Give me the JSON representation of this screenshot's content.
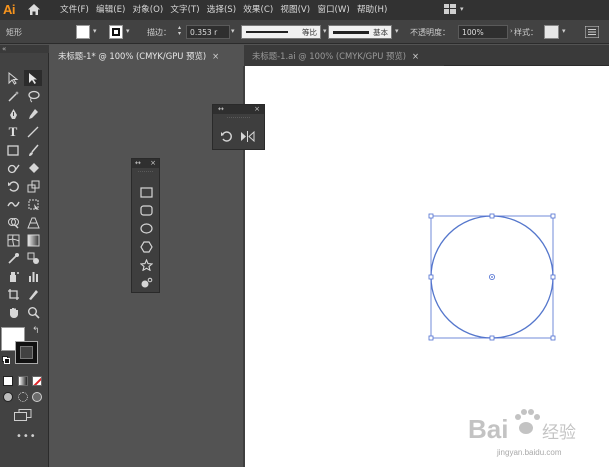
{
  "app": {
    "logo": "Ai"
  },
  "menu": [
    "文件(F)",
    "编辑(E)",
    "对象(O)",
    "文字(T)",
    "选择(S)",
    "效果(C)",
    "视图(V)",
    "窗口(W)",
    "帮助(H)"
  ],
  "control_bar": {
    "selection_label": "矩形",
    "stroke_label": "描边：",
    "stroke_weight": "0.353 r",
    "profile_1": "等比",
    "profile_2": "基本",
    "opacity_label": "不透明度：",
    "opacity_value": "100%",
    "style_label": "样式："
  },
  "tabs": [
    {
      "label": "未标题-1* @ 100% (CMYK/GPU 预览)",
      "active": true
    },
    {
      "label": "未标题-1.ai @ 100% (CMYK/GPU 预览)",
      "active": false
    }
  ],
  "icons": {
    "home": "home-icon",
    "workspace": "workspace-switcher-icon",
    "close": "close-icon",
    "collapse": "collapse-icon"
  },
  "colors": {
    "accent_logo": "#f7941d",
    "selection_blue": "#4f6fd1",
    "circle_stroke": "#5577cc",
    "ui_dark": "#323232",
    "ui_mid": "#424242",
    "ui_canvas": "#535353"
  },
  "watermark": {
    "text": "Bai 经验",
    "url": "jingyan.baidu.com"
  }
}
